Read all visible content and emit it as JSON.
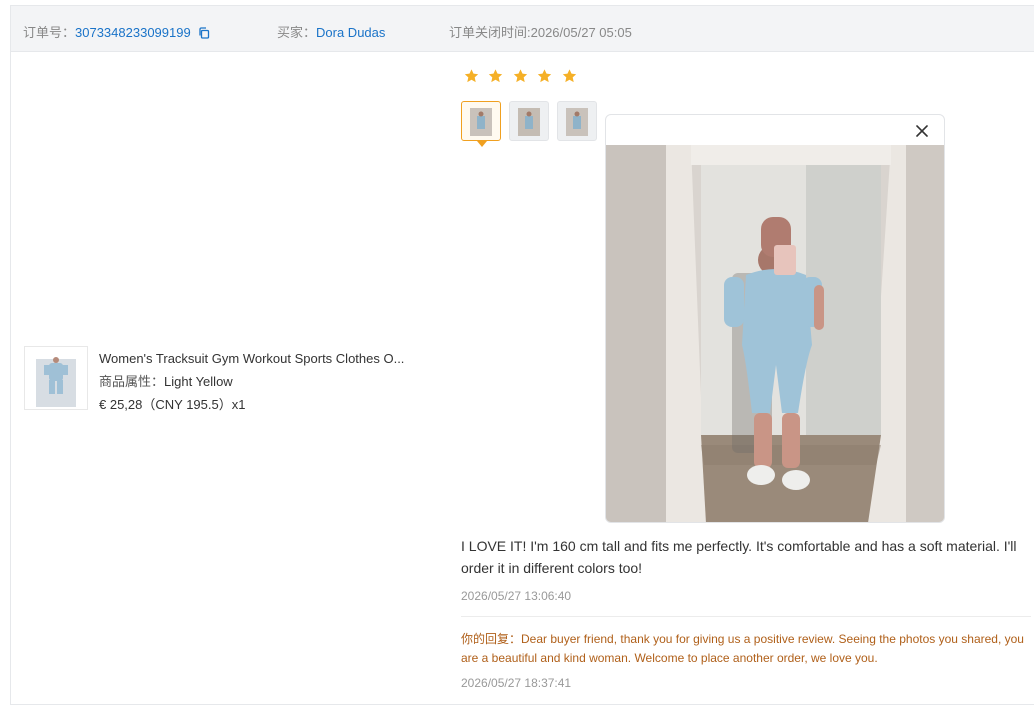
{
  "header": {
    "order_label": "订单号：",
    "order_number": "3073348233099199",
    "buyer_label": "买家：",
    "buyer_name": "Dora Dudas",
    "close_time_text": "订单关闭时间:2026/05/27 05:05"
  },
  "product": {
    "title": "Women's Tracksuit Gym Workout Sports Clothes O...",
    "property_label": "商品属性：",
    "property_value": "Light Yellow",
    "price_text": "€ 25,28（CNY  195.5）x1"
  },
  "rating": {
    "stars": 5,
    "max": 5,
    "color": "#f5b027"
  },
  "review": {
    "text": "I LOVE IT! I'm 160 cm tall and fits me perfectly. It's comfortable and has a soft material. I'll order it in different colors too!",
    "time": "2026/05/27 13:06:40",
    "photo_count": 3,
    "active_photo": 1
  },
  "reply": {
    "label": "你的回复：",
    "text": "Dear buyer friend, thank you for giving us a positive review. Seeing the photos you shared, you are a beautiful and kind woman. Welcome to place another order, we love you.",
    "time": "2026/05/27 18:37:41"
  },
  "colors": {
    "link": "#1a73c8",
    "accent": "#f0a020",
    "reply_text": "#b0601a",
    "header_bg": "#f3f4f6"
  },
  "icons": [
    "copy-icon",
    "star-icon",
    "close-icon"
  ]
}
